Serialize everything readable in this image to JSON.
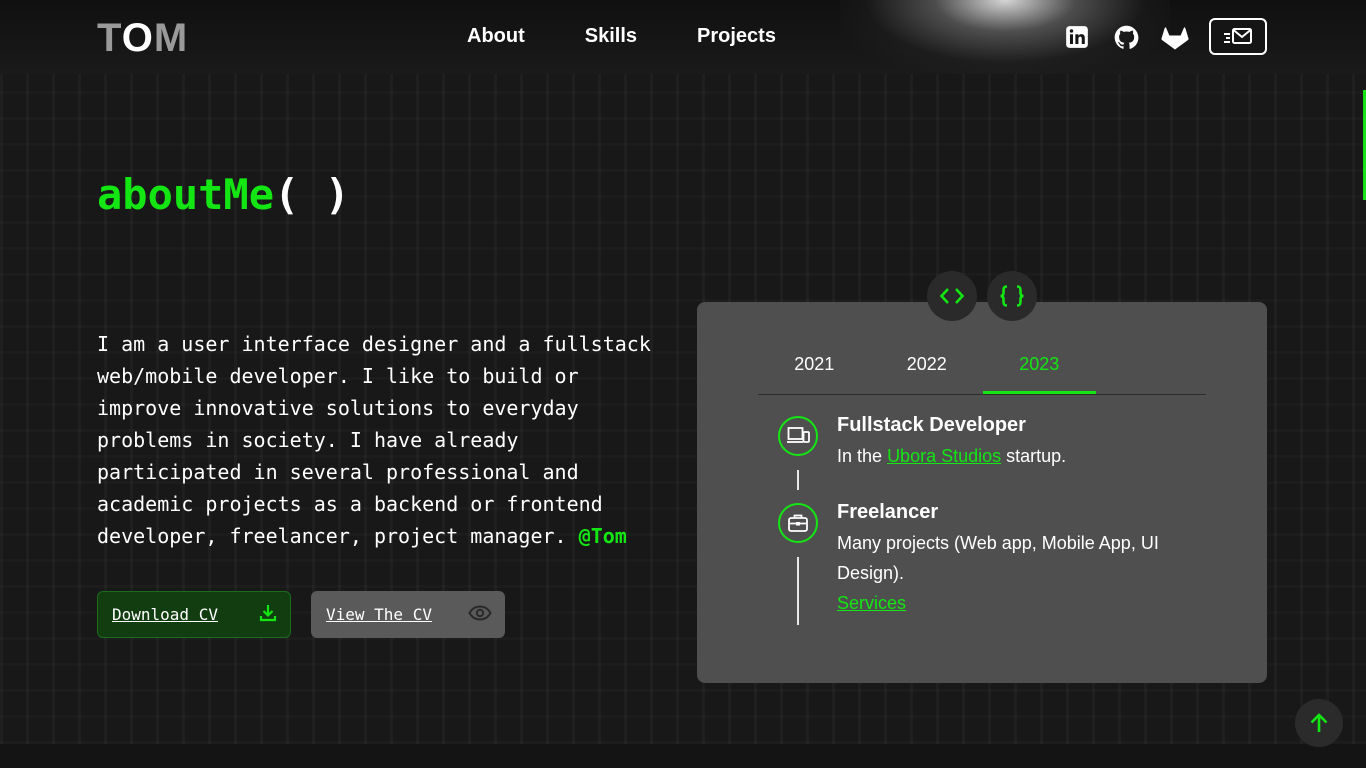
{
  "colors": {
    "accent": "#14e614",
    "background": "#151515",
    "card": "#4f4f4f"
  },
  "header": {
    "logo": {
      "letter1": "T",
      "letter2": "O",
      "letter3": "M"
    },
    "nav": [
      {
        "label": "About"
      },
      {
        "label": "Skills"
      },
      {
        "label": "Projects"
      }
    ],
    "social_icons": [
      "linkedin-icon",
      "github-icon",
      "gitlab-icon",
      "send-mail-icon"
    ]
  },
  "about": {
    "title_fn": "aboutMe",
    "title_parens": "( )",
    "intro_text": "I am a user interface designer and a fullstack web/mobile developer. I like to build or improve innovative solutions to everyday problems in society. I have already participated in several professional and academic projects as a backend or frontend developer, freelancer, project manager.",
    "handle": "@Tom",
    "download_button": "Download CV",
    "view_button": "View The CV"
  },
  "experience": {
    "toggle_icons": [
      "code-brackets-icon",
      "curly-braces-icon"
    ],
    "tabs": [
      {
        "label": "2021"
      },
      {
        "label": "2022"
      },
      {
        "label": "2023"
      }
    ],
    "active_tab": "2023",
    "items": [
      {
        "icon": "devices-icon",
        "title": "Fullstack Developer",
        "text_before": "In the",
        "link": "Ubora Studios",
        "text_after": "startup."
      },
      {
        "icon": "briefcase-icon",
        "title": "Freelancer",
        "text": "Many projects (Web app, Mobile App, UI Design).",
        "link": "Services"
      }
    ]
  },
  "scroll_top_icon": "arrow-up-icon"
}
